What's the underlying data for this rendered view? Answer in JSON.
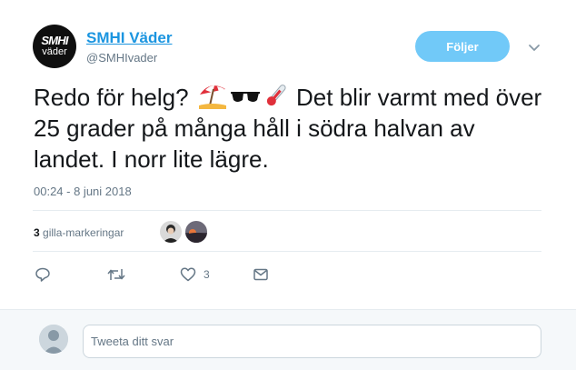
{
  "account": {
    "avatar_top": "SMHI",
    "avatar_bottom": "väder",
    "display_name": "SMHI Väder",
    "screen_name": "@SMHIvader"
  },
  "follow_button": {
    "label": "Följer"
  },
  "tweet": {
    "text": "Redo för helg? ",
    "text_after_emoji": " Det blir varmt med över 25 grader på många håll i södra halvan av landet. I norr lite lägre.",
    "emojis": [
      "beach-umbrella-icon",
      "sunglasses-icon",
      "thermometer-icon"
    ],
    "timestamp": "00:24 - 8 juni 2018"
  },
  "likes": {
    "count": "3",
    "label": "gilla-markeringar"
  },
  "actions": {
    "reply_icon": "reply-icon",
    "retweet_icon": "retweet-icon",
    "like_icon": "heart-icon",
    "like_count": "3",
    "dm_icon": "envelope-icon"
  },
  "reply": {
    "placeholder": "Tweeta ditt svar"
  },
  "colors": {
    "link": "#1b95e0",
    "follow_bg": "#71c9f8",
    "muted": "#657786",
    "border": "#e6ecf0",
    "reply_bg": "#f5f8fa"
  }
}
